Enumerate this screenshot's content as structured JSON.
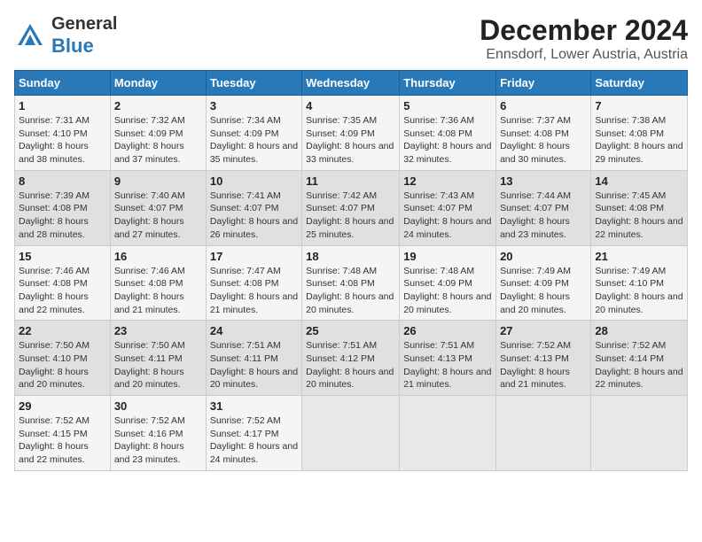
{
  "header": {
    "logo_general": "General",
    "logo_blue": "Blue",
    "title": "December 2024",
    "subtitle": "Ennsdorf, Lower Austria, Austria"
  },
  "calendar": {
    "days_of_week": [
      "Sunday",
      "Monday",
      "Tuesday",
      "Wednesday",
      "Thursday",
      "Friday",
      "Saturday"
    ],
    "weeks": [
      [
        null,
        {
          "day": "2",
          "sunrise": "Sunrise: 7:32 AM",
          "sunset": "Sunset: 4:09 PM",
          "daylight": "Daylight: 8 hours and 37 minutes."
        },
        {
          "day": "3",
          "sunrise": "Sunrise: 7:34 AM",
          "sunset": "Sunset: 4:09 PM",
          "daylight": "Daylight: 8 hours and 35 minutes."
        },
        {
          "day": "4",
          "sunrise": "Sunrise: 7:35 AM",
          "sunset": "Sunset: 4:09 PM",
          "daylight": "Daylight: 8 hours and 33 minutes."
        },
        {
          "day": "5",
          "sunrise": "Sunrise: 7:36 AM",
          "sunset": "Sunset: 4:08 PM",
          "daylight": "Daylight: 8 hours and 32 minutes."
        },
        {
          "day": "6",
          "sunrise": "Sunrise: 7:37 AM",
          "sunset": "Sunset: 4:08 PM",
          "daylight": "Daylight: 8 hours and 30 minutes."
        },
        {
          "day": "7",
          "sunrise": "Sunrise: 7:38 AM",
          "sunset": "Sunset: 4:08 PM",
          "daylight": "Daylight: 8 hours and 29 minutes."
        }
      ],
      [
        {
          "day": "1",
          "sunrise": "Sunrise: 7:31 AM",
          "sunset": "Sunset: 4:10 PM",
          "daylight": "Daylight: 8 hours and 38 minutes."
        },
        {
          "day": "9",
          "sunrise": "Sunrise: 7:40 AM",
          "sunset": "Sunset: 4:07 PM",
          "daylight": "Daylight: 8 hours and 27 minutes."
        },
        {
          "day": "10",
          "sunrise": "Sunrise: 7:41 AM",
          "sunset": "Sunset: 4:07 PM",
          "daylight": "Daylight: 8 hours and 26 minutes."
        },
        {
          "day": "11",
          "sunrise": "Sunrise: 7:42 AM",
          "sunset": "Sunset: 4:07 PM",
          "daylight": "Daylight: 8 hours and 25 minutes."
        },
        {
          "day": "12",
          "sunrise": "Sunrise: 7:43 AM",
          "sunset": "Sunset: 4:07 PM",
          "daylight": "Daylight: 8 hours and 24 minutes."
        },
        {
          "day": "13",
          "sunrise": "Sunrise: 7:44 AM",
          "sunset": "Sunset: 4:07 PM",
          "daylight": "Daylight: 8 hours and 23 minutes."
        },
        {
          "day": "14",
          "sunrise": "Sunrise: 7:45 AM",
          "sunset": "Sunset: 4:08 PM",
          "daylight": "Daylight: 8 hours and 22 minutes."
        }
      ],
      [
        {
          "day": "8",
          "sunrise": "Sunrise: 7:39 AM",
          "sunset": "Sunset: 4:08 PM",
          "daylight": "Daylight: 8 hours and 28 minutes."
        },
        {
          "day": "16",
          "sunrise": "Sunrise: 7:46 AM",
          "sunset": "Sunset: 4:08 PM",
          "daylight": "Daylight: 8 hours and 21 minutes."
        },
        {
          "day": "17",
          "sunrise": "Sunrise: 7:47 AM",
          "sunset": "Sunset: 4:08 PM",
          "daylight": "Daylight: 8 hours and 21 minutes."
        },
        {
          "day": "18",
          "sunrise": "Sunrise: 7:48 AM",
          "sunset": "Sunset: 4:08 PM",
          "daylight": "Daylight: 8 hours and 20 minutes."
        },
        {
          "day": "19",
          "sunrise": "Sunrise: 7:48 AM",
          "sunset": "Sunset: 4:09 PM",
          "daylight": "Daylight: 8 hours and 20 minutes."
        },
        {
          "day": "20",
          "sunrise": "Sunrise: 7:49 AM",
          "sunset": "Sunset: 4:09 PM",
          "daylight": "Daylight: 8 hours and 20 minutes."
        },
        {
          "day": "21",
          "sunrise": "Sunrise: 7:49 AM",
          "sunset": "Sunset: 4:10 PM",
          "daylight": "Daylight: 8 hours and 20 minutes."
        }
      ],
      [
        {
          "day": "15",
          "sunrise": "Sunrise: 7:46 AM",
          "sunset": "Sunset: 4:08 PM",
          "daylight": "Daylight: 8 hours and 22 minutes."
        },
        {
          "day": "23",
          "sunrise": "Sunrise: 7:50 AM",
          "sunset": "Sunset: 4:11 PM",
          "daylight": "Daylight: 8 hours and 20 minutes."
        },
        {
          "day": "24",
          "sunrise": "Sunrise: 7:51 AM",
          "sunset": "Sunset: 4:11 PM",
          "daylight": "Daylight: 8 hours and 20 minutes."
        },
        {
          "day": "25",
          "sunrise": "Sunrise: 7:51 AM",
          "sunset": "Sunset: 4:12 PM",
          "daylight": "Daylight: 8 hours and 20 minutes."
        },
        {
          "day": "26",
          "sunrise": "Sunrise: 7:51 AM",
          "sunset": "Sunset: 4:13 PM",
          "daylight": "Daylight: 8 hours and 21 minutes."
        },
        {
          "day": "27",
          "sunrise": "Sunrise: 7:52 AM",
          "sunset": "Sunset: 4:13 PM",
          "daylight": "Daylight: 8 hours and 21 minutes."
        },
        {
          "day": "28",
          "sunrise": "Sunrise: 7:52 AM",
          "sunset": "Sunset: 4:14 PM",
          "daylight": "Daylight: 8 hours and 22 minutes."
        }
      ],
      [
        {
          "day": "22",
          "sunrise": "Sunrise: 7:50 AM",
          "sunset": "Sunset: 4:10 PM",
          "daylight": "Daylight: 8 hours and 20 minutes."
        },
        {
          "day": "30",
          "sunrise": "Sunrise: 7:52 AM",
          "sunset": "Sunset: 4:16 PM",
          "daylight": "Daylight: 8 hours and 23 minutes."
        },
        {
          "day": "31",
          "sunrise": "Sunrise: 7:52 AM",
          "sunset": "Sunset: 4:17 PM",
          "daylight": "Daylight: 8 hours and 24 minutes."
        },
        null,
        null,
        null,
        null
      ],
      [
        {
          "day": "29",
          "sunrise": "Sunrise: 7:52 AM",
          "sunset": "Sunset: 4:15 PM",
          "daylight": "Daylight: 8 hours and 22 minutes."
        }
      ]
    ]
  }
}
